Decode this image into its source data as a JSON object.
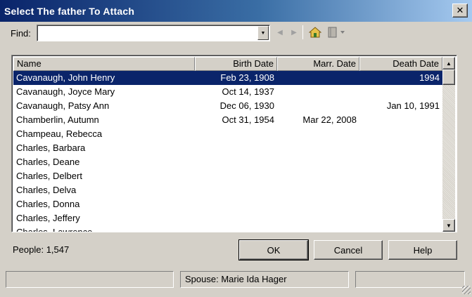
{
  "window": {
    "title": "Select The father To Attach",
    "close_glyph": "✕"
  },
  "find": {
    "label": "Find:",
    "value": "",
    "placeholder": ""
  },
  "toolbar": {
    "back_icon": "arrow-left-icon",
    "forward_icon": "arrow-right-icon",
    "home_icon": "home-icon",
    "book_icon": "book-icon"
  },
  "grid": {
    "columns": [
      "Name",
      "Birth Date",
      "Marr. Date",
      "Death Date"
    ],
    "rows": [
      {
        "name": "Cavanaugh, John Henry",
        "birth": "Feb 23, 1908",
        "marr": "",
        "death": "1994"
      },
      {
        "name": "Cavanaugh, Joyce Mary",
        "birth": "Oct 14, 1937",
        "marr": "",
        "death": ""
      },
      {
        "name": "Cavanaugh, Patsy Ann",
        "birth": "Dec 06, 1930",
        "marr": "",
        "death": "Jan 10, 1991"
      },
      {
        "name": "Chamberlin, Autumn",
        "birth": "Oct 31, 1954",
        "marr": "Mar 22, 2008",
        "death": ""
      },
      {
        "name": "Champeau, Rebecca",
        "birth": "",
        "marr": "",
        "death": ""
      },
      {
        "name": "Charles, Barbara",
        "birth": "",
        "marr": "",
        "death": ""
      },
      {
        "name": "Charles, Deane",
        "birth": "",
        "marr": "",
        "death": ""
      },
      {
        "name": "Charles, Delbert",
        "birth": "",
        "marr": "",
        "death": ""
      },
      {
        "name": "Charles, Delva",
        "birth": "",
        "marr": "",
        "death": ""
      },
      {
        "name": "Charles, Donna",
        "birth": "",
        "marr": "",
        "death": ""
      },
      {
        "name": "Charles, Jeffery",
        "birth": "",
        "marr": "",
        "death": ""
      },
      {
        "name": "Charles, Lawrence",
        "birth": "",
        "marr": "",
        "death": ""
      }
    ],
    "selected_index": 0
  },
  "footer": {
    "people_label": "People: 1,547",
    "ok_label": "OK",
    "cancel_label": "Cancel",
    "help_label": "Help"
  },
  "status": {
    "left": "",
    "middle": "Spouse: Marie Ida Hager",
    "right": ""
  },
  "colors": {
    "selection": "#0a246a",
    "face": "#d4d0c8",
    "title_start": "#0a246a",
    "title_end": "#a6caf0"
  }
}
